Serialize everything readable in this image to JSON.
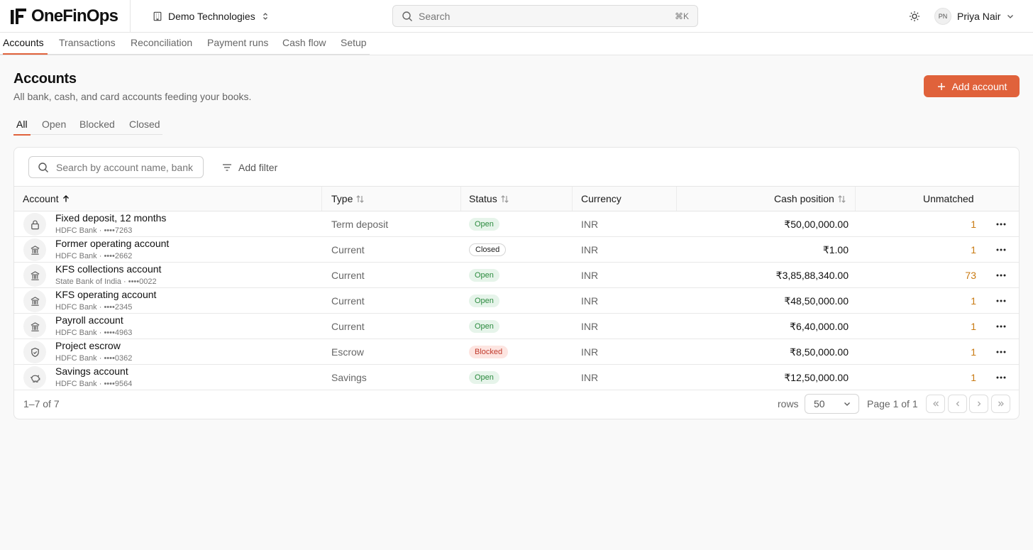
{
  "app": {
    "name": "OneFinOps",
    "org": "Demo Technologies",
    "search_placeholder": "Search",
    "search_shortcut": "⌘K",
    "user_initials": "PN",
    "user_name": "Priya Nair"
  },
  "nav": {
    "tabs": [
      "Accounts",
      "Transactions",
      "Reconciliation",
      "Payment runs",
      "Cash flow",
      "Setup"
    ],
    "active": "Accounts"
  },
  "page": {
    "title": "Accounts",
    "subtitle": "All bank, cash, and card accounts feeding your books.",
    "add_button": "Add account"
  },
  "filter_tabs": {
    "items": [
      "All",
      "Open",
      "Blocked",
      "Closed"
    ],
    "active": "All"
  },
  "table": {
    "search_placeholder": "Search by account name, bank",
    "add_filter": "Add filter",
    "columns": {
      "account": "Account",
      "type": "Type",
      "status": "Status",
      "currency": "Currency",
      "cash": "Cash position",
      "unmatched": "Unmatched"
    },
    "rows": [
      {
        "icon": "lock-icon",
        "name": "Fixed deposit, 12 months",
        "bank": "HDFC Bank · ••••7263",
        "type": "Term deposit",
        "status": "Open",
        "currency": "INR",
        "cash": "₹50,00,000.00",
        "unmatched": "1"
      },
      {
        "icon": "bank-icon",
        "name": "Former operating account",
        "bank": "HDFC Bank · ••••2662",
        "type": "Current",
        "status": "Closed",
        "currency": "INR",
        "cash": "₹1.00",
        "unmatched": "1"
      },
      {
        "icon": "bank-icon",
        "name": "KFS collections account",
        "bank": "State Bank of India · ••••0022",
        "type": "Current",
        "status": "Open",
        "currency": "INR",
        "cash": "₹3,85,88,340.00",
        "unmatched": "73"
      },
      {
        "icon": "bank-icon",
        "name": "KFS operating account",
        "bank": "HDFC Bank · ••••2345",
        "type": "Current",
        "status": "Open",
        "currency": "INR",
        "cash": "₹48,50,000.00",
        "unmatched": "1"
      },
      {
        "icon": "bank-icon",
        "name": "Payroll account",
        "bank": "HDFC Bank · ••••4963",
        "type": "Current",
        "status": "Open",
        "currency": "INR",
        "cash": "₹6,40,000.00",
        "unmatched": "1"
      },
      {
        "icon": "shield-icon",
        "name": "Project escrow",
        "bank": "HDFC Bank · ••••0362",
        "type": "Escrow",
        "status": "Blocked",
        "currency": "INR",
        "cash": "₹8,50,000.00",
        "unmatched": "1"
      },
      {
        "icon": "piggy-bank-icon",
        "name": "Savings account",
        "bank": "HDFC Bank · ••••9564",
        "type": "Savings",
        "status": "Open",
        "currency": "INR",
        "cash": "₹12,50,000.00",
        "unmatched": "1"
      }
    ]
  },
  "pagination": {
    "count": "1–7 of 7",
    "rows_label": "rows",
    "rows_value": "50",
    "page_label": "Page 1 of 1"
  },
  "colors": {
    "accent": "#e0623b",
    "open_bg": "#e6f4ea",
    "open_text": "#2b8a3e",
    "blocked_bg": "#fde5e1",
    "blocked_text": "#c0392b",
    "unmatched_text": "#c97a12"
  }
}
